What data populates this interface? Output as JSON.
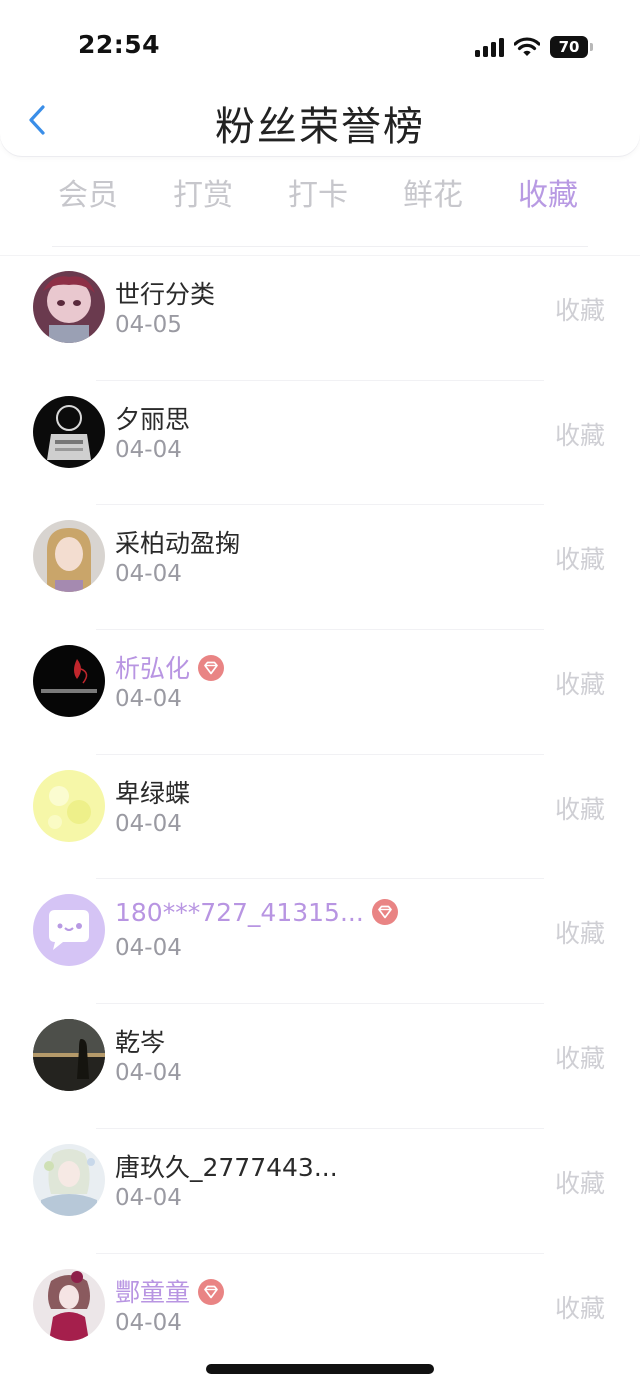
{
  "status_bar": {
    "time": "22:54",
    "battery": "70"
  },
  "header": {
    "title": "粉丝荣誉榜"
  },
  "tabs": [
    {
      "label": "会员",
      "active": false
    },
    {
      "label": "打赏",
      "active": false
    },
    {
      "label": "打卡",
      "active": false
    },
    {
      "label": "鲜花",
      "active": false
    },
    {
      "label": "收藏",
      "active": true
    }
  ],
  "colors": {
    "accent": "#b89ae3",
    "vip_badge": "#e98484",
    "inactive_tab": "#c7c7cc"
  },
  "fans": [
    {
      "name": "世行分类",
      "date": "04-05",
      "action": "收藏",
      "vip": false
    },
    {
      "name": "夕丽思",
      "date": "04-04",
      "action": "收藏",
      "vip": false
    },
    {
      "name": "采柏动盈掬",
      "date": "04-04",
      "action": "收藏",
      "vip": false
    },
    {
      "name": "析弘化",
      "date": "04-04",
      "action": "收藏",
      "vip": true
    },
    {
      "name": "卑绿蝶",
      "date": "04-04",
      "action": "收藏",
      "vip": false
    },
    {
      "name": "180***727_41315...",
      "date": "04-04",
      "action": "收藏",
      "vip": true
    },
    {
      "name": "乾岑",
      "date": "04-04",
      "action": "收藏",
      "vip": false
    },
    {
      "name": "唐玖久_2777443...",
      "date": "04-04",
      "action": "收藏",
      "vip": false
    },
    {
      "name": "酆童童",
      "date": "04-04",
      "action": "收藏",
      "vip": true
    }
  ]
}
